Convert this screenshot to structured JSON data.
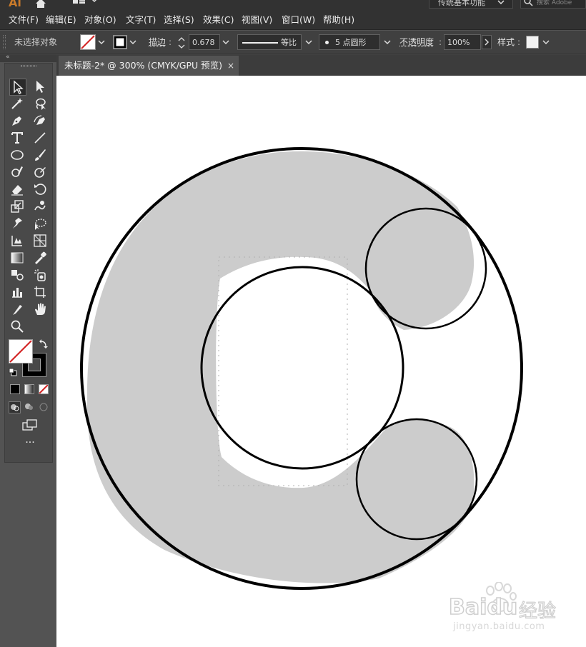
{
  "app": {
    "logo": "Ai"
  },
  "topbar": {
    "workspace": "传统基本功能",
    "search_placeholder": "搜索 Adobe"
  },
  "menu": [
    {
      "label": "文件(F)"
    },
    {
      "label": "编辑(E)"
    },
    {
      "label": "对象(O)"
    },
    {
      "label": "文字(T)"
    },
    {
      "label": "选择(S)"
    },
    {
      "label": "效果(C)"
    },
    {
      "label": "视图(V)"
    },
    {
      "label": "窗口(W)"
    },
    {
      "label": "帮助(H)"
    }
  ],
  "control": {
    "selection": "未选择对象",
    "stroke_label": "描边",
    "stroke_weight": "0.678",
    "stroke_profile": "等比",
    "brush": "5 点圆形",
    "opacity_label": "不透明度",
    "opacity_value": "100%",
    "style_label": "样式"
  },
  "document": {
    "tab_title": "未标题-2* @ 300% (CMYK/GPU 预览)",
    "close": "×"
  },
  "tools": [
    "selection-tool",
    "direct-selection-tool",
    "magic-wand-tool",
    "lasso-tool",
    "pen-tool",
    "curvature-tool",
    "type-tool",
    "line-segment-tool",
    "ellipse-tool",
    "paintbrush-tool",
    "shaper-tool",
    "blob-brush-tool",
    "eraser-tool",
    "rotate-tool",
    "scale-tool",
    "warp-tool",
    "puppet-warp-tool",
    "free-transform-tool",
    "shape-builder-tool",
    "perspective-grid-tool",
    "gradient-tool",
    "eyedropper-tool",
    "blend-tool",
    "symbol-sprayer-tool",
    "column-graph-tool",
    "artboard-tool",
    "slice-tool",
    "hand-tool",
    "zoom-tool"
  ],
  "colors": {
    "panel_bg": "#535353",
    "bar_bg": "#323232",
    "control_bg": "#404040",
    "canvas_bg": "#ffffff",
    "shape_fill": "#cccccc",
    "shape_stroke": "#000000",
    "logo": "#c97a2a"
  },
  "watermark": {
    "brand": "Baidu",
    "brand_cn": "经验",
    "url": "jingyan.baidu.com"
  }
}
